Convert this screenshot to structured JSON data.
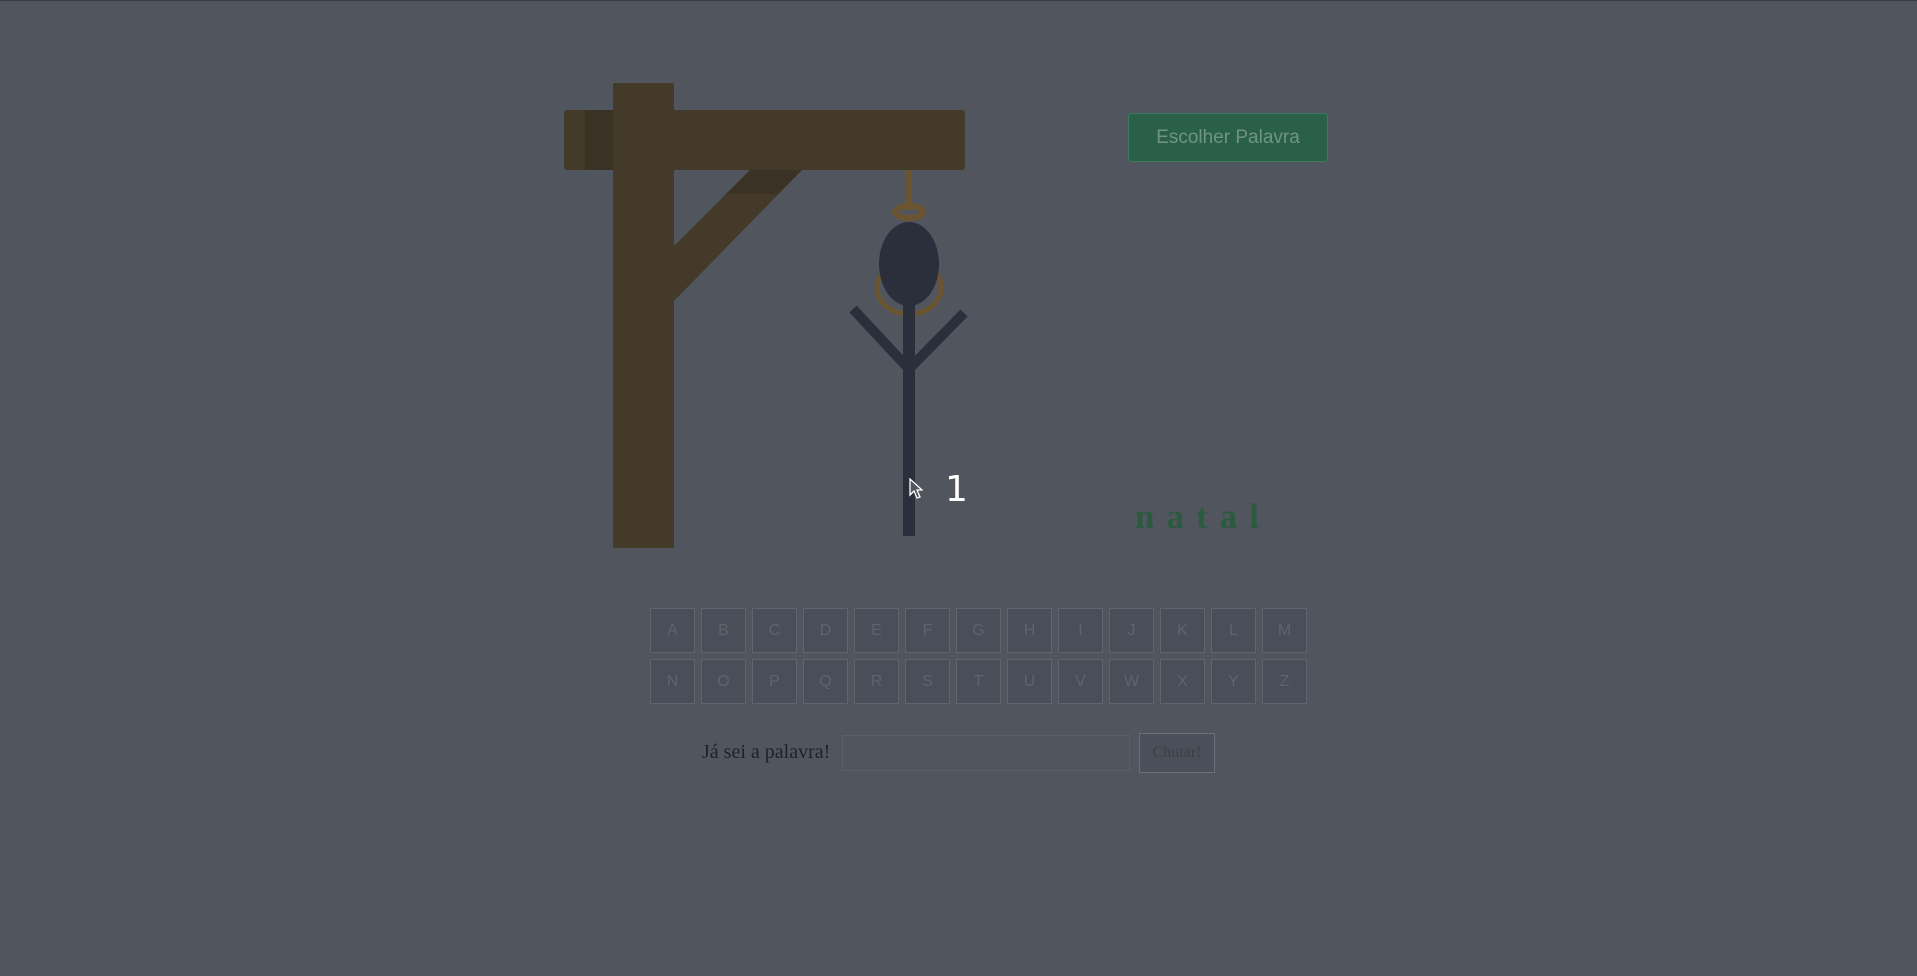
{
  "header": {
    "choose_word_label": "Escolher Palavra"
  },
  "game": {
    "counter": "1",
    "word": "natal",
    "colors": {
      "background": "#51555e",
      "wood": "#443a2a",
      "body": "#2b2f3b",
      "rope": "#6b5530",
      "word": "#2c5a3e",
      "accent": "#2a6048"
    }
  },
  "keyboard": {
    "letters": [
      "A",
      "B",
      "C",
      "D",
      "E",
      "F",
      "G",
      "H",
      "I",
      "J",
      "K",
      "L",
      "M",
      "N",
      "O",
      "P",
      "Q",
      "R",
      "S",
      "T",
      "U",
      "V",
      "W",
      "X",
      "Y",
      "Z"
    ]
  },
  "guess": {
    "label": "Já sei a palavra!",
    "input_value": "",
    "button_label": "Chutar!"
  }
}
